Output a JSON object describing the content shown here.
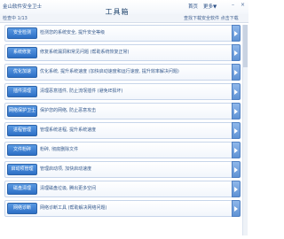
{
  "app": {
    "title": "金山软件安全卫士",
    "links": [
      "首页",
      "更多▼"
    ],
    "window_buttons": [
      "–",
      "×"
    ]
  },
  "subbar": {
    "left": "检查中 1/13",
    "center": "工具箱",
    "right": "查找下载安全软件 点击下载"
  },
  "rows": [
    {
      "button": "安全检测",
      "desc": "检测您的系统安全, 提升安全等级"
    },
    {
      "button": "系统修复",
      "desc": "修复系统漏洞和常见问题 (帮助系统恢复正常)"
    },
    {
      "button": "优化加速",
      "desc": "优化系统, 提升系统速度 (加快启动速度和运行速度, 提升效率解决问题)"
    },
    {
      "button": "插件清理",
      "desc": "清理恶意插件, 防止流氓插件 (避免IE损坏)"
    },
    {
      "button": "网络保护卫士",
      "desc": "保护您的网络, 防止恶意攻击"
    },
    {
      "button": "进程管理",
      "desc": "管理系统进程, 提升系统速度"
    },
    {
      "button": "文件粉碎",
      "desc": "粉碎, 彻底删除文件"
    },
    {
      "button": "启动项管理",
      "desc": "管理启动项, 加快启动速度"
    },
    {
      "button": "磁盘清理",
      "desc": "清理磁盘垃圾, 腾出更多空间"
    },
    {
      "button": "网络诊断",
      "desc": "网络诊断工具 (帮助解决网络问题)"
    }
  ],
  "colors": {
    "accent": "#2d6fc5",
    "text": "#365a8d",
    "border": "#c7d5ea"
  }
}
